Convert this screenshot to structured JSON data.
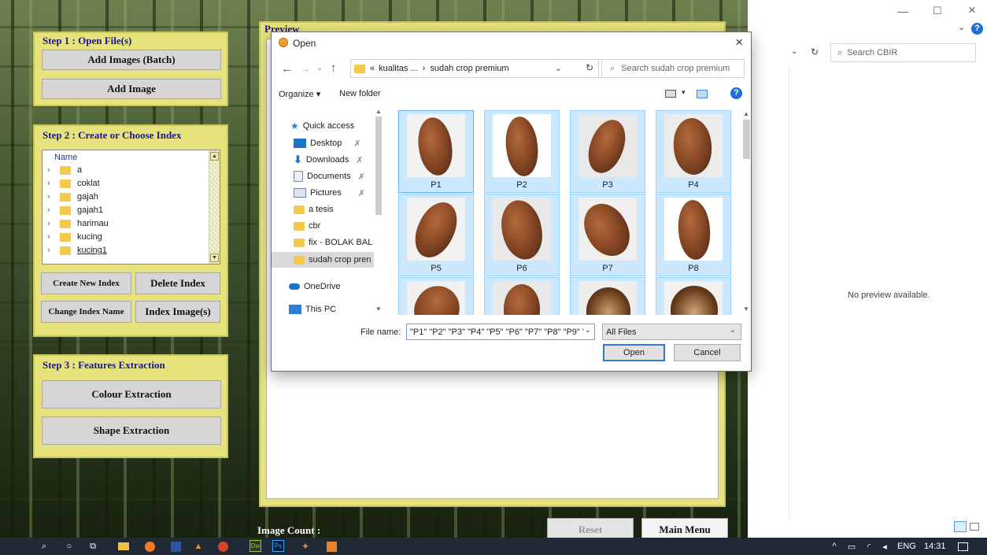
{
  "left": {
    "step1_title": "Step 1 : Open File(s)",
    "add_batch": "Add Images (Batch)",
    "add_image": "Add Image",
    "step2_title": "Step 2 : Create or Choose Index",
    "tree_header": "Name",
    "tree_items": [
      "a",
      "coklat",
      "gajah",
      "gajah1",
      "harimau",
      "kucing",
      "kucing1"
    ],
    "create_index": "Create New Index",
    "delete_index": "Delete Index",
    "change_index": "Change Index Name",
    "index_images": "Index Image(s)",
    "step3_title": "Step 3 : Features Extraction",
    "colour": "Colour Extraction",
    "shape": "Shape Extraction"
  },
  "preview": {
    "title": "Preview",
    "image_count": "Image Count :",
    "reset": "Reset",
    "main_menu": "Main Menu"
  },
  "dialog": {
    "title": "Open",
    "close": "×",
    "back": "←",
    "forward": "→",
    "up": "↑",
    "path_prefix": "«",
    "path_parent": "kualitas ...",
    "path_sep": "›",
    "path_current": "sudah crop premium",
    "search_placeholder": "Search sudah crop premium",
    "organize": "Organize ▾",
    "new_folder": "New folder",
    "nav": [
      "Quick access",
      "Desktop",
      "Downloads",
      "Documents",
      "Pictures",
      "a tesis",
      "cbr",
      "fix - BOLAK BAL",
      "sudah crop pren",
      "OneDrive",
      "This PC"
    ],
    "thumbs": [
      "P1",
      "P2",
      "P3",
      "P4",
      "P5",
      "P6",
      "P7",
      "P8"
    ],
    "file_name_label": "File name:",
    "file_name_value": "\"P1\" \"P2\" \"P3\" \"P4\" \"P5\" \"P6\" \"P7\" \"P8\" \"P9\" '",
    "file_type": "All Files",
    "open": "Open",
    "cancel": "Cancel"
  },
  "explorer": {
    "search": "Search CBIR",
    "no_preview": "No preview available."
  },
  "window_controls": {
    "minimize": "—",
    "maximize": "☐",
    "close": "×"
  },
  "taskbar": {
    "lang": "ENG",
    "time": "14:31",
    "dw": "Dw",
    "ps": "Ps"
  }
}
